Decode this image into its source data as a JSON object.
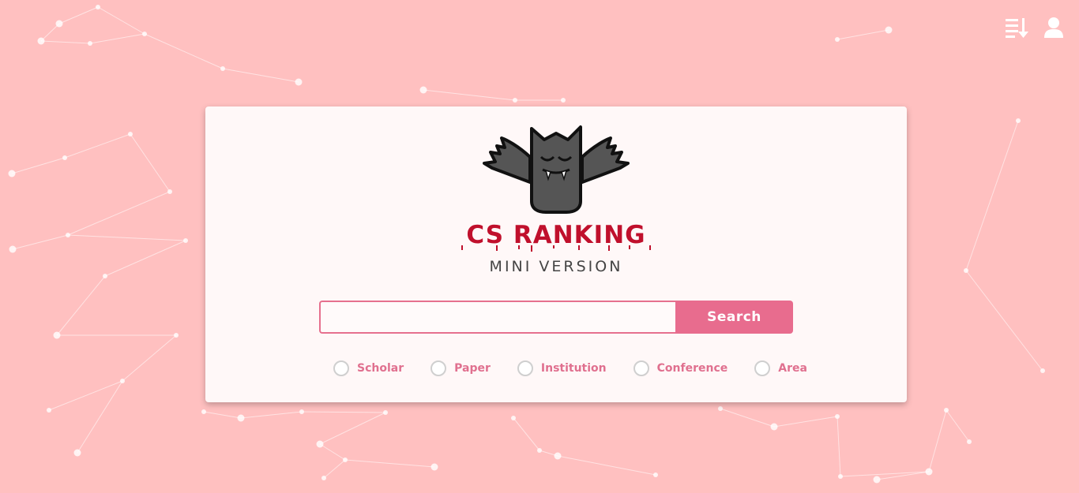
{
  "header": {
    "sort_icon": "sort-list-icon",
    "user_icon": "user-icon"
  },
  "brand": {
    "title": "CS RANKING",
    "subtitle": "MINI VERSION",
    "logo_icon": "bat-mascot-icon"
  },
  "search": {
    "value": "",
    "placeholder": "",
    "button_label": "Search"
  },
  "options": [
    {
      "label": "Scholar",
      "selected": false
    },
    {
      "label": "Paper",
      "selected": false
    },
    {
      "label": "Institution",
      "selected": false
    },
    {
      "label": "Conference",
      "selected": false
    },
    {
      "label": "Area",
      "selected": false
    }
  ],
  "colors": {
    "background": "#ffc0c0",
    "accent": "#e86c8e",
    "brand_red": "#c0102c",
    "card": "#fff8f8"
  }
}
